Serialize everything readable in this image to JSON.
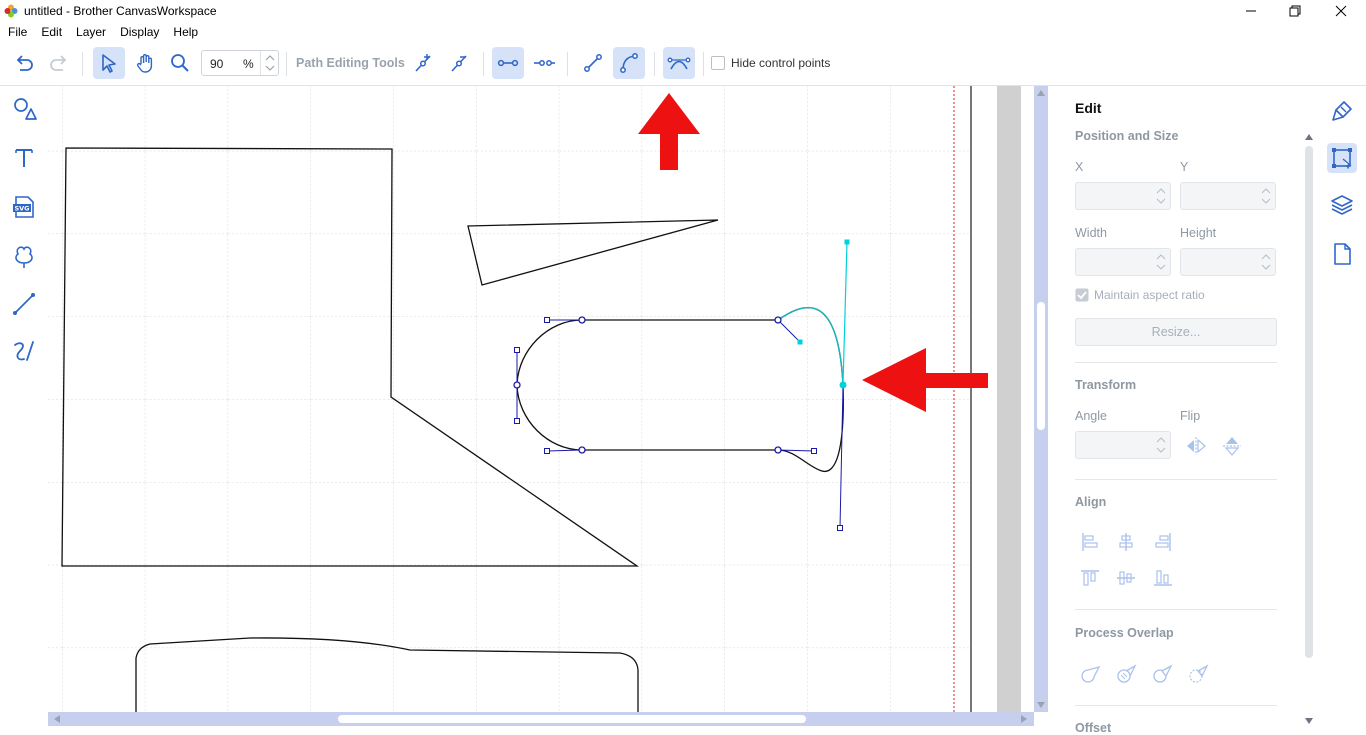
{
  "window": {
    "title": "untitled - Brother CanvasWorkspace",
    "controls": [
      "minimize",
      "restore",
      "close"
    ]
  },
  "menu": [
    "File",
    "Edit",
    "Layer",
    "Display",
    "Help"
  ],
  "toolbar": {
    "zoom_value": "90",
    "zoom_unit": "%",
    "path_editing_label": "Path Editing Tools",
    "hide_control_points_label": "Hide control points",
    "hide_control_points_checked": false,
    "icons": [
      "undo-icon",
      "redo-icon",
      "select-icon",
      "hand-pan-icon",
      "zoom-icon",
      "add-node-icon",
      "delete-node-icon",
      "join-node-icon",
      "break-node-icon",
      "line-segment-icon",
      "curve-segment-icon",
      "smooth-node-icon"
    ]
  },
  "left_tools": [
    "shapes-icon",
    "text-icon",
    "svg-import-icon",
    "pattern-icon",
    "line-draw-icon",
    "freehand-draw-icon"
  ],
  "panel": {
    "title": "Edit",
    "position_size": "Position and Size",
    "x_label": "X",
    "y_label": "Y",
    "width_label": "Width",
    "height_label": "Height",
    "maintain_aspect": "Maintain aspect ratio",
    "maintain_aspect_checked": true,
    "resize_button": "Resize...",
    "transform": "Transform",
    "angle_label": "Angle",
    "flip_label": "Flip",
    "align": "Align",
    "process_overlap": "Process Overlap",
    "offset": "Offset"
  },
  "far_right": [
    "paint-brush-icon",
    "edit-transform-icon",
    "layers-icon",
    "page-icon"
  ],
  "colors": {
    "accent": "#2f67c9",
    "active_bg": "#d6e2f7",
    "arrow": "#ee1111",
    "selected_path": "#1a1aa8",
    "handle_cyan": "#00d2d8",
    "scroll_track": "#c6d0ee"
  }
}
